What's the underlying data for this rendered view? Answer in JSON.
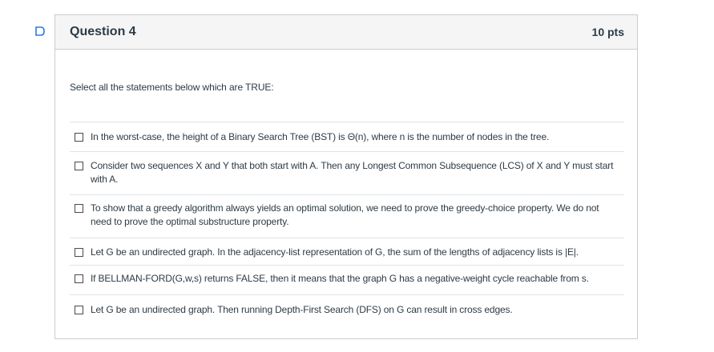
{
  "question": {
    "title": "Question 4",
    "points": "10 pts",
    "prompt": "Select all the statements below which are TRUE:"
  },
  "answers": [
    {
      "text": "In the worst-case, the height of a Binary Search Tree (BST) is Θ(n), where n is the number of nodes in the tree.",
      "checked": false
    },
    {
      "text": "Consider two sequences X and Y that both start with A. Then any Longest Common Subsequence (LCS) of X and Y must start with A.",
      "checked": false
    },
    {
      "text": "To show that a greedy algorithm always yields an optimal solution, we need to prove the greedy-choice property. We do not need to prove the optimal substructure property.",
      "checked": false
    },
    {
      "text": "Let G be an undirected graph. In the adjacency-list representation of G, the sum of the lengths of adjacency lists is |E|.",
      "checked": false
    },
    {
      "text": "If BELLMAN-FORD(G,w,s) returns FALSE, then it means that the graph G has a negative-weight cycle reachable from s.",
      "checked": false
    },
    {
      "text": "Let G be an undirected graph. Then running Depth-First Search (DFS) on G can result in cross edges.",
      "checked": false
    }
  ],
  "colors": {
    "accent": "#2d7bd6",
    "text": "#2d3b45",
    "border": "#c7cdd1",
    "header_bg": "#f5f5f5"
  },
  "icons": {
    "marker": "bookmark-bracket-icon",
    "checkbox": "checkbox-unchecked-icon"
  }
}
